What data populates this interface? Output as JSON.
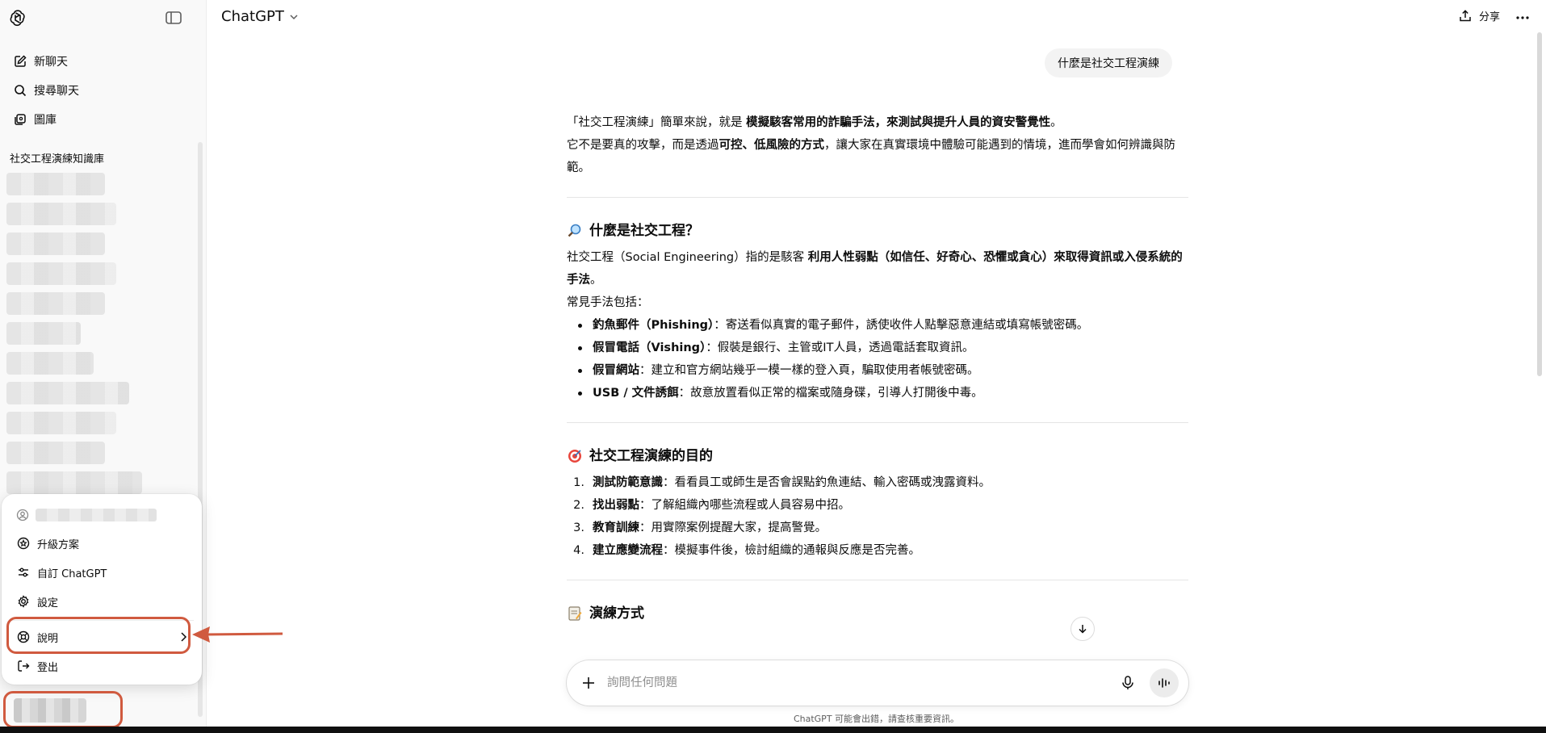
{
  "sidebar": {
    "nav": [
      {
        "label": "新聊天",
        "icon": "edit-icon"
      },
      {
        "label": "搜尋聊天",
        "icon": "search-icon"
      },
      {
        "label": "圖庫",
        "icon": "library-icon"
      }
    ],
    "section_title": "社交工程演練知識庫"
  },
  "menu": {
    "items": [
      {
        "label": "升級方案",
        "icon": "upgrade-icon"
      },
      {
        "label": "自訂 ChatGPT",
        "icon": "customize-icon"
      },
      {
        "label": "設定",
        "icon": "gear-icon"
      },
      {
        "label": "說明",
        "icon": "help-icon"
      },
      {
        "label": "登出",
        "icon": "logout-icon"
      }
    ]
  },
  "header": {
    "model": "ChatGPT",
    "share": "分享"
  },
  "chat": {
    "user_message": "什麼是社交工程演練",
    "intro_p1": [
      "「社交工程演練」簡單來說，就是 ",
      "模擬駭客常用的詐騙手法，來測試與提升人員的資安警覺性",
      "。"
    ],
    "intro_p2": [
      "它不是要真的攻擊，而是透過",
      "可控、低風險的方式",
      "，讓大家在真實環境中體驗可能遇到的情境，進而學會如何辨識與防範。"
    ],
    "section1_title": "什麼是社交工程？",
    "section1_p": [
      "社交工程（Social Engineering）指的是駭客 ",
      "利用人性弱點（如信任、好奇心、恐懼或貪心）來取得資訊或入侵系統的手法",
      "。"
    ],
    "section1_lead": "常見手法包括：",
    "section1_list": [
      {
        "bold": "釣魚郵件（Phishing）",
        "text": "：寄送看似真實的電子郵件，誘使收件人點擊惡意連結或填寫帳號密碼。"
      },
      {
        "bold": "假冒電話（Vishing）",
        "text": "：假裝是銀行、主管或IT人員，透過電話套取資訊。"
      },
      {
        "bold": "假冒網站",
        "text": "：建立和官方網站幾乎一模一樣的登入頁，騙取使用者帳號密碼。"
      },
      {
        "bold": "USB / 文件誘餌",
        "text": "：故意放置看似正常的檔案或隨身碟，引導人打開後中毒。"
      }
    ],
    "section2_title": "社交工程演練的目的",
    "section2_list": [
      {
        "n": "1.",
        "bold": "測試防範意識",
        "text": "：看看員工或師生是否會誤點釣魚連結、輸入密碼或洩露資料。"
      },
      {
        "n": "2.",
        "bold": "找出弱點",
        "text": "：了解組織內哪些流程或人員容易中招。"
      },
      {
        "n": "3.",
        "bold": "教育訓練",
        "text": "：用實際案例提醒大家，提高警覺。"
      },
      {
        "n": "4.",
        "bold": "建立應變流程",
        "text": "：模擬事件後，檢討組織的通報與反應是否完善。"
      }
    ],
    "section3_title": "演練方式"
  },
  "composer": {
    "placeholder": "詢問任何問題"
  },
  "footnote": "ChatGPT 可能會出錯，請查核重要資訊。",
  "colors": {
    "annotation": "#d05a3f",
    "sidebar_bg": "#f9f9f9",
    "bubble_bg": "#f3f3f3"
  }
}
